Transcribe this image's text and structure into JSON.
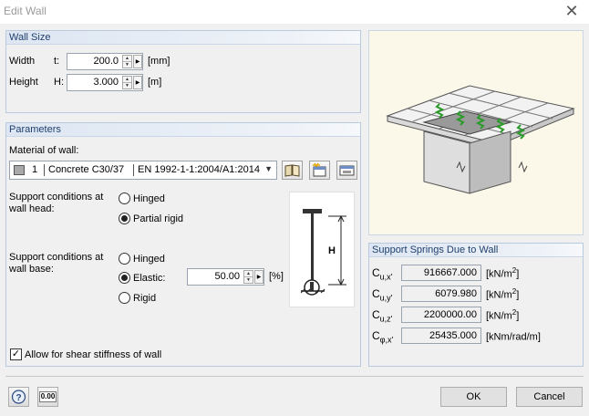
{
  "window": {
    "title": "Edit Wall",
    "close": "✕"
  },
  "wall_size": {
    "header": "Wall Size",
    "width": {
      "label": "Width",
      "symbol": "t:",
      "value": "200.0",
      "unit": "[mm]"
    },
    "height": {
      "label": "Height",
      "symbol": "H:",
      "value": "3.000",
      "unit": "[m]"
    }
  },
  "parameters": {
    "header": "Parameters",
    "material_label": "Material of wall:",
    "material": {
      "number": "1",
      "name": "Concrete C30/37",
      "standard": "EN 1992-1-1:2004/A1:2014"
    },
    "head": {
      "label_line1": "Support conditions at",
      "label_line2": "wall head:",
      "options": [
        {
          "label": "Hinged",
          "selected": false
        },
        {
          "label": "Partial rigid",
          "selected": true
        }
      ]
    },
    "base": {
      "label_line1": "Support conditions at",
      "label_line2": "wall base:",
      "options": [
        {
          "label": "Hinged",
          "selected": false
        },
        {
          "label": "Elastic:",
          "selected": true
        },
        {
          "label": "Rigid",
          "selected": false
        }
      ],
      "elastic_value": "50.00",
      "elastic_unit": "[%]"
    },
    "diagram_label": "H",
    "shear_checkbox": {
      "label": "Allow for shear stiffness of wall",
      "checked": true
    }
  },
  "springs": {
    "header": "Support Springs Due to Wall",
    "rows": [
      {
        "sym": "C",
        "sub": "u,x'",
        "value": "916667.000",
        "unit": "[kN/m",
        "sup": "2",
        "unit_end": "]"
      },
      {
        "sym": "C",
        "sub": "u,y'",
        "value": "6079.980",
        "unit": "[kN/m",
        "sup": "2",
        "unit_end": "]"
      },
      {
        "sym": "C",
        "sub": "u,z'",
        "value": "2200000.00",
        "unit": "[kN/m",
        "sup": "2",
        "unit_end": "]"
      },
      {
        "sym": "C",
        "sub": "φ,x'",
        "value": "25435.000",
        "unit": "[kNm/rad/m]",
        "sup": "",
        "unit_end": ""
      }
    ]
  },
  "footer": {
    "ok": "OK",
    "cancel": "Cancel",
    "zero_icon_text": "0.00"
  }
}
